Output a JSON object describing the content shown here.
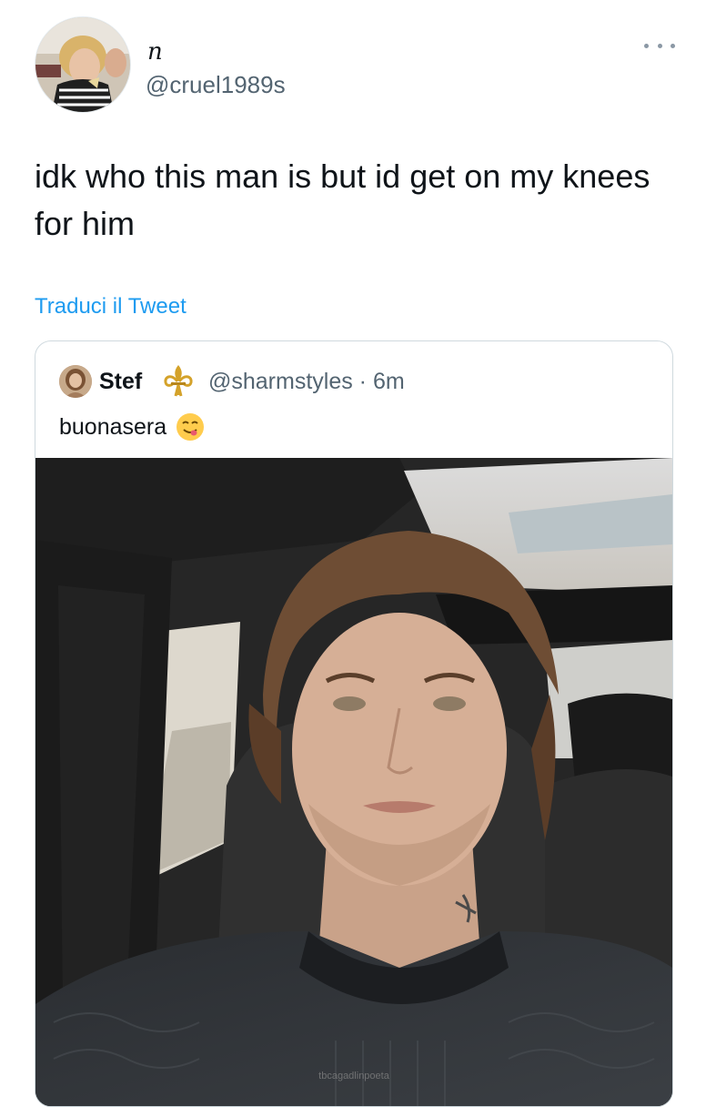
{
  "author": {
    "display_name": "n",
    "handle": "@cruel1989s",
    "avatar_icon": "profile-photo"
  },
  "tweet": {
    "text": "idk who this man is but id get on my knees for him",
    "translate_label": "Traduci il Tweet"
  },
  "quoted_tweet": {
    "display_name": "Stef",
    "badge_icon": "fleur-de-lis-icon",
    "meta": "@sharmstyles · 6m",
    "text": "buonasera",
    "emoji_icon": "yum-face-emoji",
    "media_watermark": "tbcagadlinpoeta"
  },
  "colors": {
    "link": "#1d9bf0",
    "secondary_text": "#536471",
    "border": "#cfd9de",
    "fleur_gold": "#d4a22a"
  }
}
